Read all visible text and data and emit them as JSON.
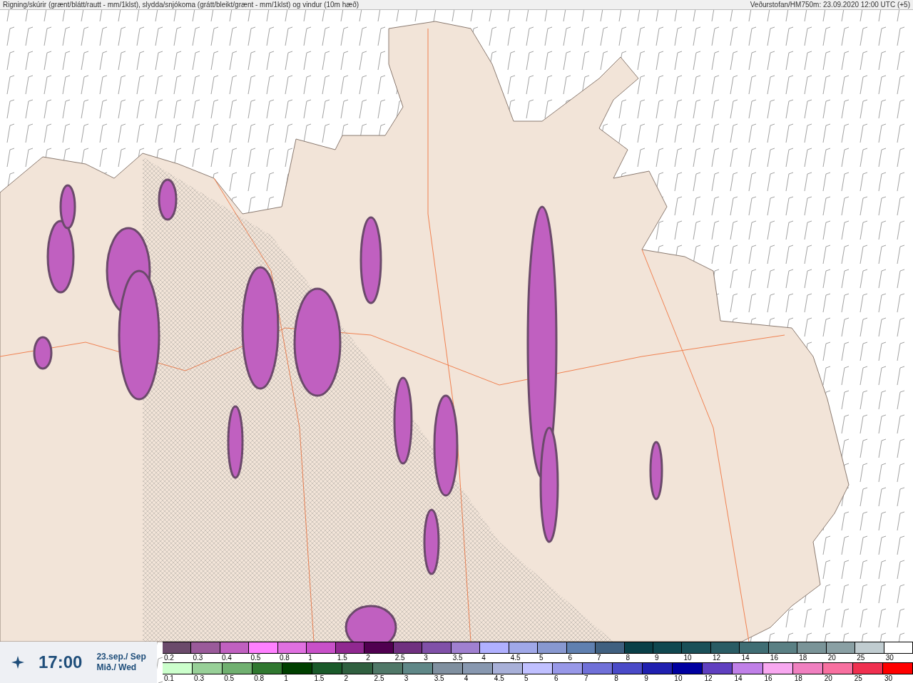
{
  "header": {
    "title": "Rigning/skúrir (grænt/blátt/rautt - mm/1klst), slydda/snjókoma (grátt/bleikt/grænt - mm/1klst) og vindur (10m hæð)",
    "source": "Veðurstofan/HM750m: 23.09.2020 12:00 UTC (+5)"
  },
  "time_box": {
    "time": "17:00",
    "date": "23.sep./ Sep",
    "weekday": "Mið./ Wed"
  },
  "legends": [
    {
      "items": [
        {
          "label": "0.2",
          "color": "#6b4a6b"
        },
        {
          "label": "0.3",
          "color": "#9a5a9a"
        },
        {
          "label": "0.4",
          "color": "#c060c0"
        },
        {
          "label": "0.5",
          "color": "#ff80ff"
        },
        {
          "label": "0.8",
          "color": "#e070e0"
        },
        {
          "label": "1",
          "color": "#c850c8"
        },
        {
          "label": "1.5",
          "color": "#902890"
        },
        {
          "label": "2",
          "color": "#500050"
        },
        {
          "label": "2.5",
          "color": "#703080"
        },
        {
          "label": "3",
          "color": "#8050a8"
        },
        {
          "label": "3.5",
          "color": "#a080d0"
        },
        {
          "label": "4",
          "color": "#b0b0ff"
        },
        {
          "label": "4.5",
          "color": "#a0a8e8"
        },
        {
          "label": "5",
          "color": "#8898d0"
        },
        {
          "label": "6",
          "color": "#6080b0"
        },
        {
          "label": "7",
          "color": "#406080"
        },
        {
          "label": "8",
          "color": "#0a4048"
        },
        {
          "label": "9",
          "color": "#104850"
        },
        {
          "label": "10",
          "color": "#1a5058"
        },
        {
          "label": "12",
          "color": "#2a5c64"
        },
        {
          "label": "14",
          "color": "#406e74"
        },
        {
          "label": "16",
          "color": "#5a8084"
        },
        {
          "label": "18",
          "color": "#7a9498"
        },
        {
          "label": "20",
          "color": "#8aa0a4"
        },
        {
          "label": "25",
          "color": "#c0ccd0"
        },
        {
          "label": "30",
          "color": "#ffffff"
        }
      ]
    },
    {
      "items": [
        {
          "label": "0.1",
          "color": "#ccffcc"
        },
        {
          "label": "0.3",
          "color": "#98d098"
        },
        {
          "label": "0.5",
          "color": "#70b070"
        },
        {
          "label": "0.8",
          "color": "#307830"
        },
        {
          "label": "1",
          "color": "#004000"
        },
        {
          "label": "1.5",
          "color": "#1a5a2a"
        },
        {
          "label": "2",
          "color": "#306040"
        },
        {
          "label": "2.5",
          "color": "#507868"
        },
        {
          "label": "3",
          "color": "#608888"
        },
        {
          "label": "3.5",
          "color": "#8090a0"
        },
        {
          "label": "4",
          "color": "#8898b0"
        },
        {
          "label": "4.5",
          "color": "#a8b0d8"
        },
        {
          "label": "5",
          "color": "#c0c0ff"
        },
        {
          "label": "6",
          "color": "#9898e8"
        },
        {
          "label": "7",
          "color": "#7070d8"
        },
        {
          "label": "8",
          "color": "#4a4ac8"
        },
        {
          "label": "9",
          "color": "#2020b0"
        },
        {
          "label": "10",
          "color": "#0000a0"
        },
        {
          "label": "12",
          "color": "#6040c0"
        },
        {
          "label": "14",
          "color": "#c080e8"
        },
        {
          "label": "16",
          "color": "#f8a8f0"
        },
        {
          "label": "18",
          "color": "#f080c0"
        },
        {
          "label": "20",
          "color": "#f870a0"
        },
        {
          "label": "25",
          "color": "#f03050"
        },
        {
          "label": "30",
          "color": "#ff0000"
        }
      ]
    }
  ]
}
